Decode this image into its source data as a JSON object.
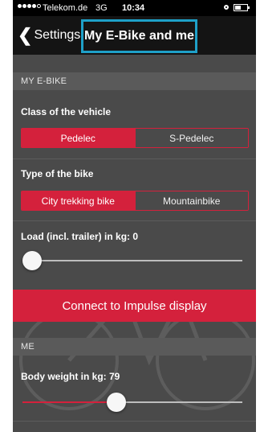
{
  "status_bar": {
    "carrier": "Telekom.de",
    "network": "3G",
    "time": "10:34"
  },
  "nav": {
    "back_label": "Settings",
    "title": "My E-Bike and me",
    "highlight_color": "#1ea0c8"
  },
  "ebike_section": {
    "header": "MY E-BIKE",
    "vehicle_class": {
      "label": "Class of the vehicle",
      "options": [
        "Pedelec",
        "S-Pedelec"
      ],
      "selected": "Pedelec"
    },
    "bike_type": {
      "label": "Type of the bike",
      "options": [
        "City trekking bike",
        "Mountainbike"
      ],
      "selected": "City trekking bike"
    },
    "load": {
      "label": "Load (incl. trailer) in kg: 0",
      "value": 0,
      "fraction": 0.0
    }
  },
  "connect_button": {
    "label": "Connect to Impulse display"
  },
  "me_section": {
    "header": "ME",
    "body_weight": {
      "label": "Body weight in kg: 79",
      "value": 79,
      "fraction": 0.42
    }
  },
  "colors": {
    "accent_red": "#d4213c",
    "background": "#4a4a4a",
    "navbar": "#141414"
  }
}
